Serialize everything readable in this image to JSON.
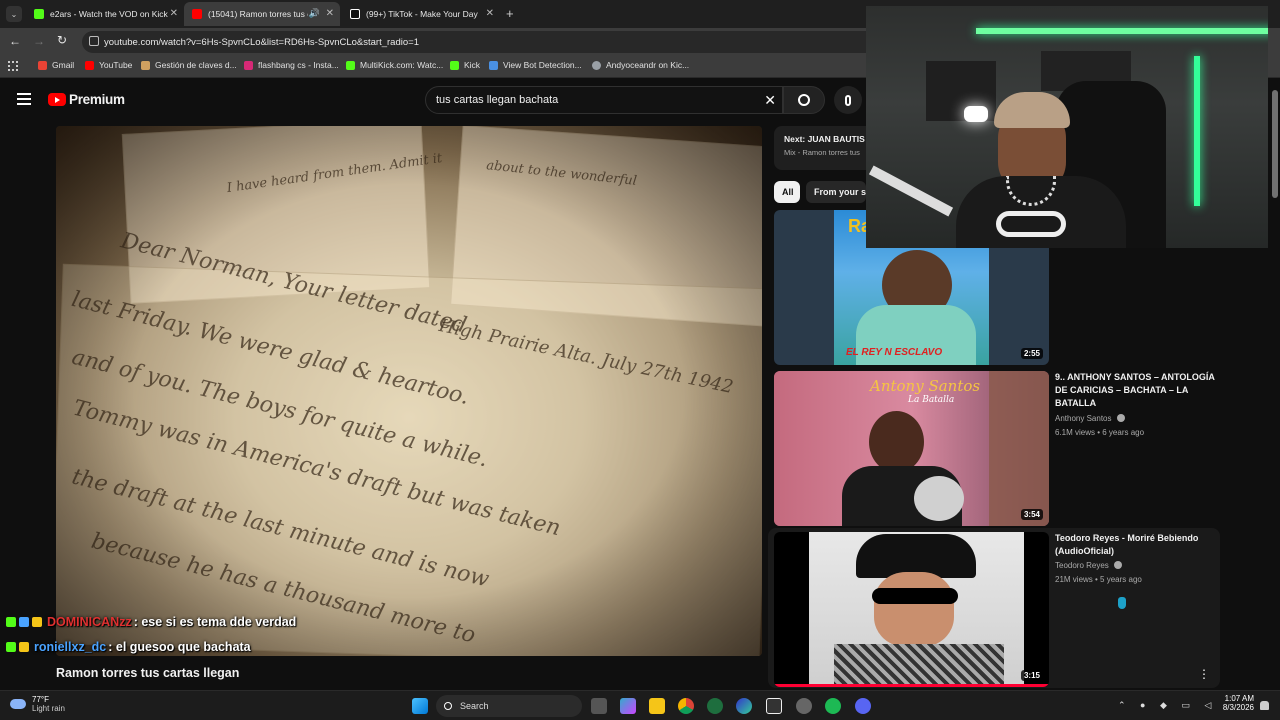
{
  "tabs": [
    {
      "label": "e2ars - Watch the VOD on Kick",
      "favicon": "kick-icon",
      "color": "#53fc18"
    },
    {
      "label": "(15041) Ramon torres tus ca",
      "favicon": "youtube-icon",
      "color": "#ff0000"
    },
    {
      "label": "(99+) TikTok - Make Your Day",
      "favicon": "tiktok-icon",
      "color": "#ffffff"
    }
  ],
  "address": {
    "url": "youtube.com/watch?v=6Hs-SpvnCLo&list=RD6Hs-SpvnCLo&start_radio=1"
  },
  "bookmarks": [
    {
      "label": "Gmail",
      "color": "#ea4335"
    },
    {
      "label": "YouTube",
      "color": "#ff0000"
    },
    {
      "label": "Gestión de claves d...",
      "color": "#d0a060"
    },
    {
      "label": "flashbang cs - Insta...",
      "color": "#d62976"
    },
    {
      "label": "MultiKick.com: Watc...",
      "color": "#53fc18"
    },
    {
      "label": "Kick",
      "color": "#53fc18"
    },
    {
      "label": "View Bot Detection...",
      "color": "#4a90e2"
    },
    {
      "label": "Andyoceandr on Kic...",
      "color": "#9aa0a6"
    }
  ],
  "youtube": {
    "logo_text": "Premium",
    "search_value": "tus cartas llegan bachata"
  },
  "player": {
    "title": "Ramon torres tus cartas llegan"
  },
  "next": {
    "label": "Next: JUAN BAUTIS",
    "sub": "Mix - Ramon torres tus"
  },
  "chips": [
    {
      "label": "All"
    },
    {
      "label": "From your se"
    }
  ],
  "videos": [
    {
      "title": "",
      "channel": "",
      "stats": "",
      "duration": "2:55",
      "thumb_text": "EL REY N ESCLAVO",
      "brand_text": "Ra"
    },
    {
      "title": "9.. ANTHONY SANTOS – ANTOLOGÍA DE CARICIAS – BACHATA – LA BATALLA",
      "channel": "Anthony Santos",
      "stats": "6.1M views • 6 years ago",
      "duration": "3:54",
      "thumb_text": "Antony Santos",
      "thumb_sub": "La Batalla"
    },
    {
      "title": "Teodoro Reyes - Moriré Bebiendo (AudioOficial)",
      "channel": "Teodoro Reyes",
      "stats": "21M views • 5 years ago",
      "duration": "3:15"
    }
  ],
  "chat": [
    {
      "user": "DOMINICANzz",
      "message": ": ese si es tema dde verdad",
      "color": "#e03030"
    },
    {
      "user": "roniellxz_dc",
      "message": ": el guesoo que bachata",
      "color": "#4aa3ff"
    }
  ],
  "taskbar": {
    "weather_temp": "77°F",
    "weather_desc": "Light rain",
    "search_label": "Search",
    "time": "1:07 AM",
    "date": "8/3/2026"
  }
}
